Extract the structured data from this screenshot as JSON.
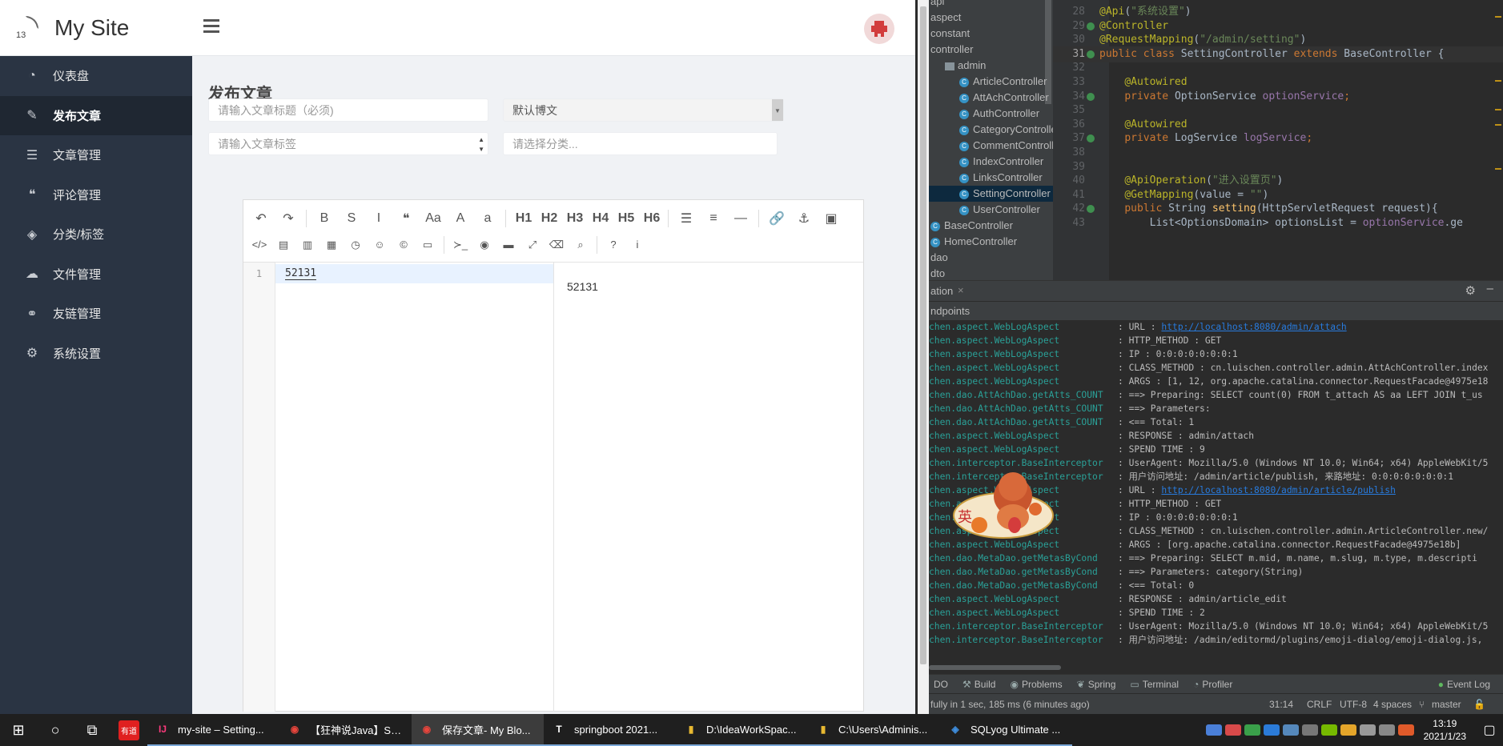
{
  "sidebar": {
    "brand_number": "13",
    "brand_title": "My Site",
    "items": [
      {
        "icon": "dashboard-icon",
        "glyph": "◔",
        "label": "仪表盘",
        "active": false
      },
      {
        "icon": "edit-icon",
        "glyph": "✎",
        "label": "发布文章",
        "active": true
      },
      {
        "icon": "list-icon",
        "glyph": "☰",
        "label": "文章管理",
        "active": false
      },
      {
        "icon": "comments-icon",
        "glyph": "❝",
        "label": "评论管理",
        "active": false
      },
      {
        "icon": "tags-icon",
        "glyph": "◈",
        "label": "分类/标签",
        "active": false
      },
      {
        "icon": "cloud-upload-icon",
        "glyph": "☁",
        "label": "文件管理",
        "active": false
      },
      {
        "icon": "link-icon",
        "glyph": "⚭",
        "label": "友链管理",
        "active": false
      },
      {
        "icon": "gear-icon",
        "glyph": "⚙",
        "label": "系统设置",
        "active": false
      }
    ]
  },
  "main": {
    "page_title": "发布文章",
    "title_placeholder": "请输入文章标题（必须)",
    "type_select": "默认博文",
    "tags_placeholder": "请输入文章标签",
    "category_placeholder": "请选择分类...",
    "editor": {
      "toolbar_row1": [
        "↶",
        "↷",
        "B",
        "S",
        "I",
        "❝",
        "Aa",
        "A",
        "a",
        "H1",
        "H2",
        "H3",
        "H4",
        "H5",
        "H6",
        "☰",
        "≡",
        "—",
        "🔗",
        "⚓",
        "▣"
      ],
      "toolbar_row2": [
        "</>",
        "▤",
        "▥",
        "▦",
        "◷",
        "☺",
        "©",
        "▭",
        "≻_",
        "◉",
        "▬",
        "⤢",
        "⌫",
        "⌕",
        "?",
        "i"
      ],
      "line_number": "1",
      "content": "52131",
      "preview": "52131"
    }
  },
  "ide": {
    "tree": [
      {
        "label": "api",
        "type": "folder",
        "indent": 0
      },
      {
        "label": "aspect",
        "type": "folder",
        "indent": 0
      },
      {
        "label": "constant",
        "type": "folder",
        "indent": 0
      },
      {
        "label": "controller",
        "type": "folder",
        "indent": 0
      },
      {
        "label": "admin",
        "type": "folder",
        "indent": 1
      },
      {
        "label": "ArticleController",
        "type": "class",
        "indent": 2
      },
      {
        "label": "AttAchController",
        "type": "class",
        "indent": 2
      },
      {
        "label": "AuthController",
        "type": "class",
        "indent": 2
      },
      {
        "label": "CategoryController",
        "type": "class",
        "indent": 2
      },
      {
        "label": "CommentController",
        "type": "class",
        "indent": 2
      },
      {
        "label": "IndexController",
        "type": "class",
        "indent": 2
      },
      {
        "label": "LinksController",
        "type": "class",
        "indent": 2
      },
      {
        "label": "SettingController",
        "type": "class",
        "indent": 2,
        "selected": true
      },
      {
        "label": "UserController",
        "type": "class",
        "indent": 2
      },
      {
        "label": "BaseController",
        "type": "class",
        "indent": 0
      },
      {
        "label": "HomeController",
        "type": "class",
        "indent": 0
      },
      {
        "label": "dao",
        "type": "folder",
        "indent": 0
      },
      {
        "label": "dto",
        "type": "folder",
        "indent": 0
      }
    ],
    "code": [
      {
        "n": "28",
        "html": "<span class='an'>@Api</span><span class='plain'>(</span><span class='str'>\"系统设置\"</span><span class='plain'>)</span>"
      },
      {
        "n": "29",
        "html": "<span class='an'>@Controller</span>"
      },
      {
        "n": "30",
        "html": "<span class='an'>@RequestMapping</span><span class='plain'>(</span><span class='str'>\"/admin/setting\"</span><span class='plain'>)</span>"
      },
      {
        "n": "31",
        "html": "<span class='kw'>public class </span><span class='cls'>SettingController </span><span class='kw'>extends </span><span class='cls'>BaseController {</span>"
      },
      {
        "n": "32",
        "html": ""
      },
      {
        "n": "33",
        "html": "    <span class='an'>@Autowired</span>"
      },
      {
        "n": "34",
        "html": "    <span class='kw'>private </span><span class='cls'>OptionService </span><span class='fld'>optionService</span><span class='kw'>;</span>"
      },
      {
        "n": "35",
        "html": ""
      },
      {
        "n": "36",
        "html": "    <span class='an'>@Autowired</span>"
      },
      {
        "n": "37",
        "html": "    <span class='kw'>private </span><span class='cls'>LogService </span><span class='fld'>logService</span><span class='kw'>;</span>"
      },
      {
        "n": "38",
        "html": ""
      },
      {
        "n": "39",
        "html": ""
      },
      {
        "n": "40",
        "html": "    <span class='an'>@ApiOperation</span><span class='plain'>(</span><span class='str'>\"进入设置页\"</span><span class='plain'>)</span>"
      },
      {
        "n": "41",
        "html": "    <span class='an'>@GetMapping</span><span class='plain'>(value = </span><span class='str'>\"\"</span><span class='plain'>)</span>"
      },
      {
        "n": "42",
        "html": "    <span class='kw'>public </span><span class='cls'>String </span><span class='fn'>setting</span><span class='plain'>(HttpServletRequest request){</span>"
      },
      {
        "n": "43",
        "html": "        <span class='cls'>List&lt;OptionsDomain&gt; optionsList = </span><span class='fld'>optionService</span><span class='plain'>.ge</span>"
      }
    ],
    "run_tab": "ation",
    "run_sub": "ndpoints",
    "log": [
      {
        "logger": "chen.aspect.WebLogAspect",
        "msg": ": URL : ",
        "link": "http://localhost:8080/admin/attach"
      },
      {
        "logger": "chen.aspect.WebLogAspect",
        "msg": ": HTTP_METHOD : GET"
      },
      {
        "logger": "chen.aspect.WebLogAspect",
        "msg": ": IP : 0:0:0:0:0:0:0:1"
      },
      {
        "logger": "chen.aspect.WebLogAspect",
        "msg": ": CLASS_METHOD : cn.luischen.controller.admin.AttAchController.index"
      },
      {
        "logger": "chen.aspect.WebLogAspect",
        "msg": ": ARGS : [1, 12, org.apache.catalina.connector.RequestFacade@4975e18"
      },
      {
        "logger": "chen.dao.AttAchDao.getAtts_COUNT",
        "msg": ": ==>  Preparing: SELECT count(0) FROM t_attach AS aa LEFT JOIN t_us"
      },
      {
        "logger": "chen.dao.AttAchDao.getAtts_COUNT",
        "msg": ": ==> Parameters: "
      },
      {
        "logger": "chen.dao.AttAchDao.getAtts_COUNT",
        "msg": ": <==      Total: 1"
      },
      {
        "logger": "chen.aspect.WebLogAspect",
        "msg": ": RESPONSE : admin/attach"
      },
      {
        "logger": "chen.aspect.WebLogAspect",
        "msg": ": SPEND TIME : 9"
      },
      {
        "logger": "chen.interceptor.BaseInterceptor",
        "msg": ": UserAgent: Mozilla/5.0 (Windows NT 10.0; Win64; x64) AppleWebKit/5"
      },
      {
        "logger": "chen.interceptor.BaseInterceptor",
        "msg": ": 用户访问地址: /admin/article/publish, 来路地址: 0:0:0:0:0:0:0:1"
      },
      {
        "logger": "chen.aspect.WebLogAspect",
        "msg": ": URL : ",
        "link": "http://localhost:8080/admin/article/publish"
      },
      {
        "logger": "chen.aspect.WebLogAspect",
        "msg": ": HTTP_METHOD : GET"
      },
      {
        "logger": "chen.aspect.WebLogAspect",
        "msg": ": IP : 0:0:0:0:0:0:0:1"
      },
      {
        "logger": "chen.aspect.WebLogAspect",
        "msg": ": CLASS_METHOD : cn.luischen.controller.admin.ArticleController.new/"
      },
      {
        "logger": "chen.aspect.WebLogAspect",
        "msg": ": ARGS : [org.apache.catalina.connector.RequestFacade@4975e18b]"
      },
      {
        "logger": "chen.dao.MetaDao.getMetasByCond",
        "msg": ": ==>  Preparing: SELECT m.mid, m.name, m.slug, m.type, m.descripti"
      },
      {
        "logger": "chen.dao.MetaDao.getMetasByCond",
        "msg": ": ==> Parameters: category(String)"
      },
      {
        "logger": "chen.dao.MetaDao.getMetasByCond",
        "msg": ": <==      Total: 0"
      },
      {
        "logger": "chen.aspect.WebLogAspect",
        "msg": ": RESPONSE : admin/article_edit"
      },
      {
        "logger": "chen.aspect.WebLogAspect",
        "msg": ": SPEND TIME : 2"
      },
      {
        "logger": "chen.interceptor.BaseInterceptor",
        "msg": ": UserAgent: Mozilla/5.0 (Windows NT 10.0; Win64; x64) AppleWebKit/5"
      },
      {
        "logger": "chen.interceptor.BaseInterceptor",
        "msg": ": 用户访问地址: /admin/editormd/plugins/emoji-dialog/emoji-dialog.js,"
      }
    ],
    "tool_windows": [
      {
        "icon": "todo-icon",
        "glyph": "",
        "label": "DO"
      },
      {
        "icon": "build-icon",
        "glyph": "⚒",
        "label": "Build"
      },
      {
        "icon": "problems-icon",
        "glyph": "◉",
        "label": "Problems"
      },
      {
        "icon": "spring-icon",
        "glyph": "❦",
        "label": "Spring"
      },
      {
        "icon": "terminal-icon",
        "glyph": "▭",
        "label": "Terminal"
      },
      {
        "icon": "profiler-icon",
        "glyph": "◔",
        "label": "Profiler"
      }
    ],
    "event_log": "Event Log",
    "status_msg": "fully in 1 sec, 185 ms (6 minutes ago)",
    "status_pos": "31:14",
    "status_crlf": "CRLF",
    "status_enc": "UTF-8",
    "status_indent": "4 spaces",
    "status_branch": "master"
  },
  "taskbar": {
    "tasks": [
      {
        "icon": "intellij-icon",
        "glyph": "IJ",
        "color": "#fc3a7c",
        "label": "my-site – Setting..."
      },
      {
        "icon": "chrome-icon",
        "glyph": "◉",
        "color": "#e8453c",
        "label": "【狂神说Java】Sp..."
      },
      {
        "icon": "chrome-icon",
        "glyph": "◉",
        "color": "#e8453c",
        "label": "保存文章- My Blo...",
        "active": true
      },
      {
        "icon": "typora-icon",
        "glyph": "T",
        "color": "#ffffff",
        "label": "springboot 2021..."
      },
      {
        "icon": "folder-icon",
        "glyph": "▮",
        "color": "#e8b931",
        "label": "D:\\IdeaWorkSpac..."
      },
      {
        "icon": "folder-icon",
        "glyph": "▮",
        "color": "#e8b931",
        "label": "C:\\Users\\Adminis..."
      },
      {
        "icon": "sqlyog-icon",
        "glyph": "◈",
        "color": "#3f8ede",
        "label": "SQLyog Ultimate ..."
      }
    ],
    "youdao_label": "有道",
    "time": "13:19",
    "date": "2021/1/23"
  }
}
